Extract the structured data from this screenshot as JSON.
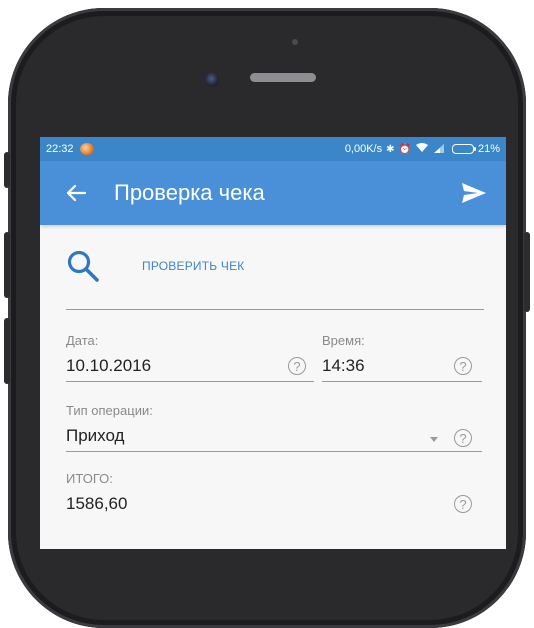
{
  "statusbar": {
    "time": "22:32",
    "net_speed": "0,00K/s",
    "battery": "21%",
    "icons": [
      "notification-icon",
      "bluetooth-icon",
      "alarm-icon",
      "wifi-icon",
      "signal-icon",
      "battery-icon"
    ]
  },
  "appbar": {
    "title": "Проверка чека",
    "back_icon": "arrow-left-icon",
    "send_icon": "send-icon"
  },
  "check": {
    "icon": "search-icon",
    "label": "ПРОВЕРИТЬ ЧЕК"
  },
  "form": {
    "date": {
      "label": "Дата:",
      "value": "10.10.2016"
    },
    "time": {
      "label": "Время:",
      "value": "14:36"
    },
    "operation": {
      "label": "Тип операции:",
      "value": "Приход"
    },
    "total": {
      "label": "ИТОГО:",
      "value": "1586,60"
    },
    "help_glyph": "?"
  },
  "colors": {
    "statusbar": "#3b86c9",
    "appbar": "#4a90d9",
    "accent": "#3b86c9"
  }
}
